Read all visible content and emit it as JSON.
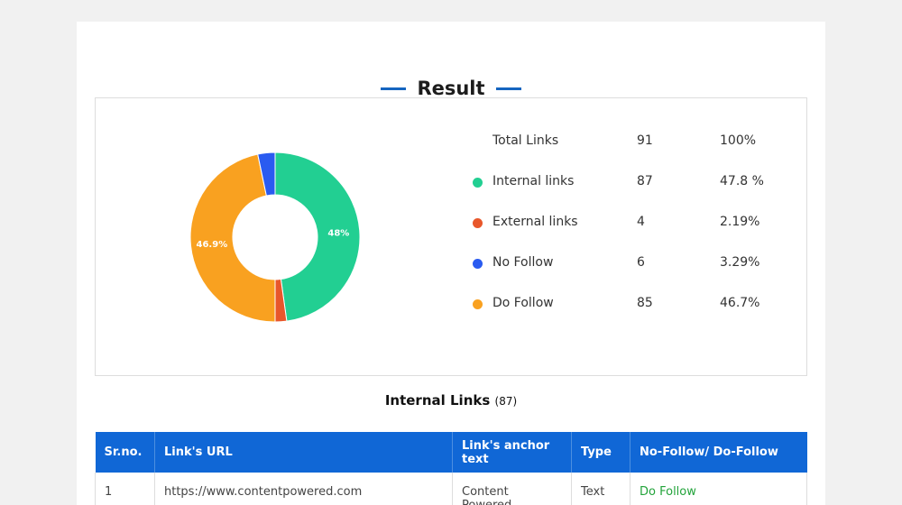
{
  "header": {
    "title": "Result"
  },
  "summary": {
    "rows": [
      {
        "label": "Total Links",
        "count": "91",
        "percent": "100%",
        "color": null
      },
      {
        "label": "Internal links",
        "count": "87",
        "percent": "47.8 %",
        "color": "#22cf92"
      },
      {
        "label": "External links",
        "count": "4",
        "percent": "2.19%",
        "color": "#e8572b"
      },
      {
        "label": "No Follow",
        "count": "6",
        "percent": "3.29%",
        "color": "#2a5bf0"
      },
      {
        "label": "Do Follow",
        "count": "85",
        "percent": "46.7%",
        "color": "#f9a120"
      }
    ]
  },
  "chart_data": {
    "type": "pie",
    "variant": "donut",
    "slices": [
      {
        "name": "Internal links",
        "value": 47.8,
        "label": "48%",
        "color": "#22cf92"
      },
      {
        "name": "External links",
        "value": 2.19,
        "label": "",
        "color": "#e8572b"
      },
      {
        "name": "Do Follow",
        "value": 46.7,
        "label": "46.9%",
        "color": "#f9a120"
      },
      {
        "name": "No Follow",
        "value": 3.29,
        "label": "",
        "color": "#2a5bf0"
      }
    ]
  },
  "internal_links": {
    "title": "Internal Links",
    "count": "(87)",
    "columns": [
      "Sr.no.",
      "Link's URL",
      "Link's anchor text",
      "Type",
      "No-Follow/ Do-Follow"
    ],
    "rows": [
      {
        "sr": "1",
        "url": "https://www.contentpowered.com",
        "anchor": "Content Powered",
        "type": "Text",
        "follow": "Do Follow"
      }
    ]
  }
}
